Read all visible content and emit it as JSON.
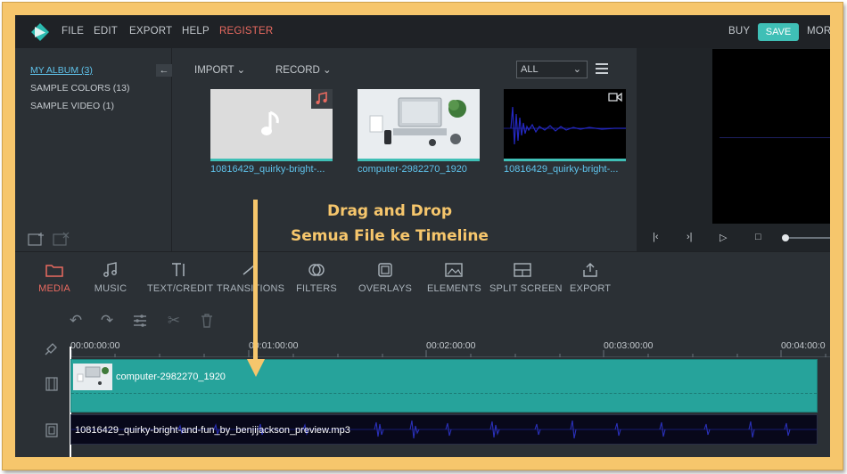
{
  "menu": {
    "file": "FILE",
    "edit": "EDIT",
    "export": "EXPORT",
    "help": "HELP",
    "register": "REGISTER",
    "buy": "BUY",
    "save": "SAVE",
    "more": "MOR"
  },
  "album": {
    "items": [
      {
        "label": "MY ALBUM (3)"
      },
      {
        "label": "SAMPLE COLORS (13)"
      },
      {
        "label": "SAMPLE VIDEO (1)"
      }
    ]
  },
  "media_toolbar": {
    "import": "IMPORT",
    "record": "RECORD",
    "filter": "ALL"
  },
  "media": {
    "items": [
      {
        "label": "10816429_quirky-bright-..."
      },
      {
        "label": "computer-2982270_1920"
      },
      {
        "label": "10816429_quirky-bright-..."
      }
    ]
  },
  "tabs": [
    {
      "label": "MEDIA"
    },
    {
      "label": "MUSIC"
    },
    {
      "label": "TEXT/CREDIT"
    },
    {
      "label": "TRANSITIONS"
    },
    {
      "label": "FILTERS"
    },
    {
      "label": "OVERLAYS"
    },
    {
      "label": "ELEMENTS"
    },
    {
      "label": "SPLIT SCREEN"
    },
    {
      "label": "EXPORT"
    }
  ],
  "timeline": {
    "ticks": [
      "00:00:00:00",
      "00:01:00:00",
      "00:02:00:00",
      "00:03:00:00",
      "00:04:00:0"
    ],
    "video_clip": "computer-2982270_1920",
    "audio_clip": "10816429_quirky-bright-and-fun_by_benjijackson_preview.mp3"
  },
  "annotation": {
    "line1": "Drag and Drop",
    "line2": "Semua File ke Timeline"
  },
  "colors": {
    "accent": "#3fbfb6",
    "active_tab": "#e96a60",
    "link": "#5fc2ea",
    "annotation": "#f6c66c"
  }
}
